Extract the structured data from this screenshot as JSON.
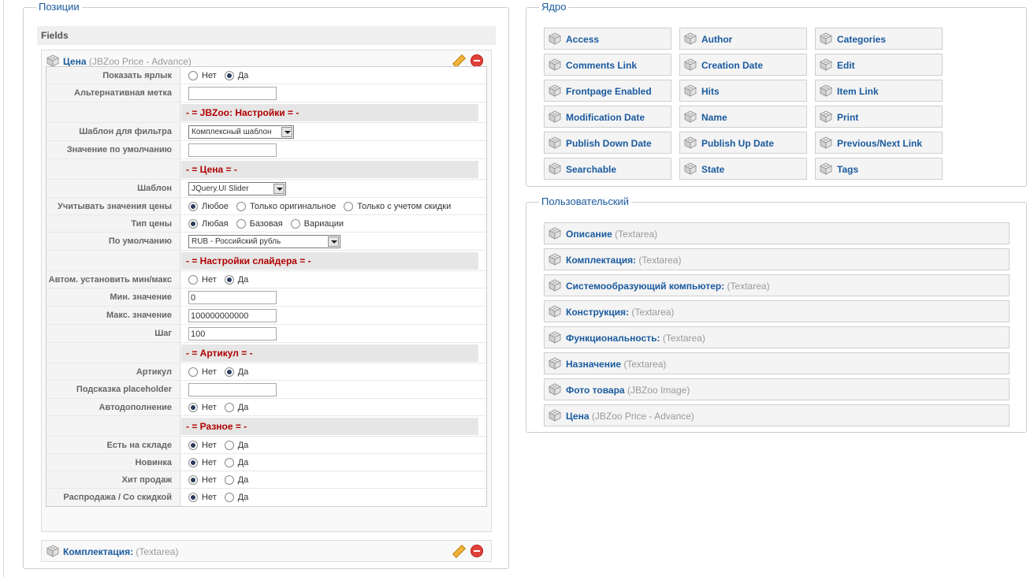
{
  "left_panel": {
    "legend": "Позиции",
    "fields_header": "Fields",
    "element1": {
      "name": "Цена",
      "type": "(JBZoo Price - Advance)",
      "rows": [
        {
          "kind": "radio",
          "label": "Показать ярлык",
          "options": [
            "Нет",
            "Да"
          ],
          "selected": 1
        },
        {
          "kind": "text",
          "label": "Альтернативная метка",
          "value": ""
        },
        {
          "kind": "sep",
          "text": "- = JBZoo: Настройки = -"
        },
        {
          "kind": "select",
          "label": "Шаблон для фильтра",
          "value": "Комплексный шаблон"
        },
        {
          "kind": "text",
          "label": "Значение по умолчанию",
          "value": ""
        },
        {
          "kind": "sep",
          "text": "- = Цена = -"
        },
        {
          "kind": "select",
          "label": "Шаблон",
          "value": "JQuery.UI Slider"
        },
        {
          "kind": "radio",
          "label": "Учитывать значения цены",
          "options": [
            "Любое",
            "Только оригинальное",
            "Только с учетом скидки"
          ],
          "selected": 0
        },
        {
          "kind": "radio",
          "label": "Тип цены",
          "options": [
            "Любая",
            "Базовая",
            "Вариации"
          ],
          "selected": 0
        },
        {
          "kind": "select",
          "label": "По умолчанию",
          "value": "RUB - Российский рубль"
        },
        {
          "kind": "sep",
          "text": "- = Настройки слайдера = -"
        },
        {
          "kind": "radio",
          "label": "Автом. установить мин/макс",
          "options": [
            "Нет",
            "Да"
          ],
          "selected": 1
        },
        {
          "kind": "text",
          "label": "Мин. значение",
          "value": "0"
        },
        {
          "kind": "text",
          "label": "Макс. значение",
          "value": "100000000000"
        },
        {
          "kind": "text",
          "label": "Шаг",
          "value": "100"
        },
        {
          "kind": "sep",
          "text": "- = Артикул = -"
        },
        {
          "kind": "radio",
          "label": "Артикул",
          "options": [
            "Нет",
            "Да"
          ],
          "selected": 1
        },
        {
          "kind": "text",
          "label": "Подсказка placeholder",
          "value": ""
        },
        {
          "kind": "radio",
          "label": "Автодополнение",
          "options": [
            "Нет",
            "Да"
          ],
          "selected": 0
        },
        {
          "kind": "sep",
          "text": "- = Разное = -"
        },
        {
          "kind": "radio",
          "label": "Есть на складе",
          "options": [
            "Нет",
            "Да"
          ],
          "selected": 0
        },
        {
          "kind": "radio",
          "label": "Новинка",
          "options": [
            "Нет",
            "Да"
          ],
          "selected": 0
        },
        {
          "kind": "radio",
          "label": "Хит продаж",
          "options": [
            "Нет",
            "Да"
          ],
          "selected": 0
        },
        {
          "kind": "radio",
          "label": "Распродажа / Со скидкой",
          "options": [
            "Нет",
            "Да"
          ],
          "selected": 0
        }
      ]
    },
    "element2": {
      "name": "Комплектация:",
      "type": "(Textarea)"
    }
  },
  "core_panel": {
    "legend": "Ядро",
    "items": [
      "Access",
      "Author",
      "Categories",
      "Comments Link",
      "Creation Date",
      "Edit",
      "Frontpage Enabled",
      "Hits",
      "Item Link",
      "Modification Date",
      "Name",
      "Print",
      "Publish Down Date",
      "Publish Up Date",
      "Previous/Next Link",
      "Searchable",
      "State",
      "Tags"
    ]
  },
  "user_panel": {
    "legend": "Пользовательский",
    "items": [
      {
        "name": "Описание",
        "type": "(Textarea)"
      },
      {
        "name": "Комплектация:",
        "type": "(Textarea)"
      },
      {
        "name": "Системообразующий компьютер:",
        "type": "(Textarea)"
      },
      {
        "name": "Конструкция:",
        "type": "(Textarea)"
      },
      {
        "name": "Функциональность:",
        "type": "(Textarea)"
      },
      {
        "name": "Назначение",
        "type": "(Textarea)"
      },
      {
        "name": "Фото товара",
        "type": "(JBZoo Image)"
      },
      {
        "name": "Цена",
        "type": "(JBZoo Price - Advance)"
      }
    ]
  },
  "colors": {
    "link": "#1a5a9e",
    "separator_text": "#b00000",
    "delete_icon": "#e0403a"
  }
}
